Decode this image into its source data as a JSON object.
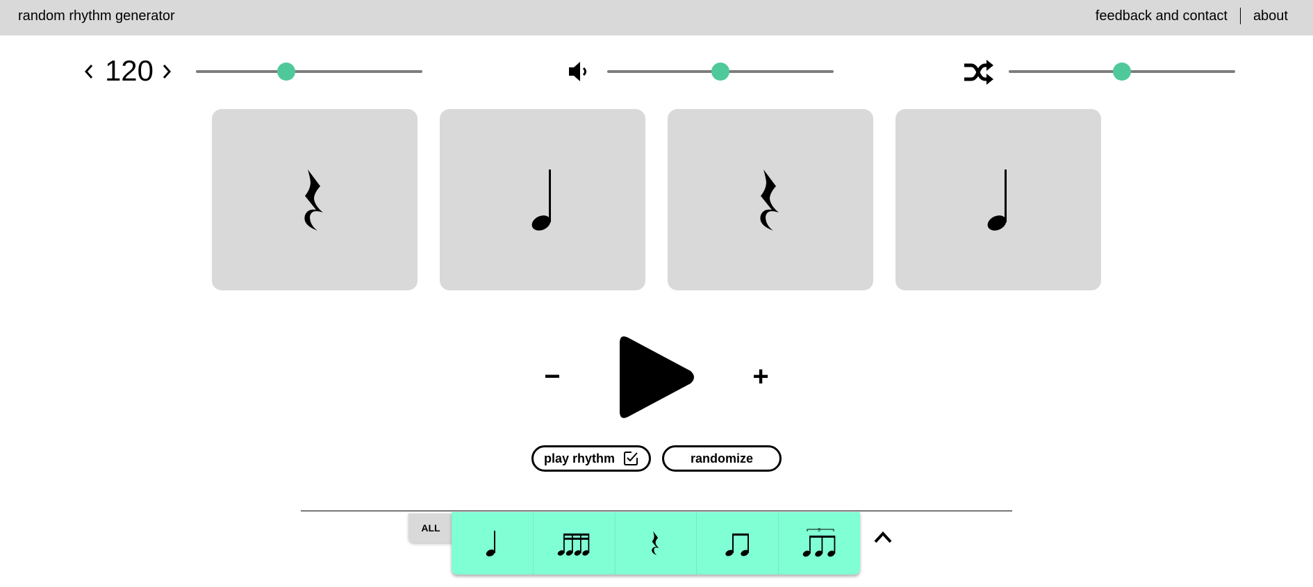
{
  "header": {
    "title": "random rhythm generator",
    "links": [
      "feedback and contact",
      "about"
    ]
  },
  "controls": {
    "tempo": {
      "value": "120",
      "slider_fraction": 0.4
    },
    "volume": {
      "slider_fraction": 0.5
    },
    "randomness": {
      "slider_fraction": 0.5
    }
  },
  "cards": [
    "quarter-rest",
    "quarter-note",
    "quarter-rest",
    "quarter-note"
  ],
  "playback": {
    "minus_label": "−",
    "plus_label": "+",
    "play_rhythm_label": "play rhythm",
    "play_rhythm_checked": true,
    "randomize_label": "randomize"
  },
  "palette": {
    "all_label": "ALL",
    "items": [
      "quarter-note",
      "sixteenth-notes",
      "quarter-rest",
      "eighth-notes",
      "eighth-triplet"
    ],
    "triplet_label": "3"
  },
  "colors": {
    "accent": "#4fc99a",
    "palette_bg": "#80ffd4",
    "panel": "#d9d9d9"
  }
}
